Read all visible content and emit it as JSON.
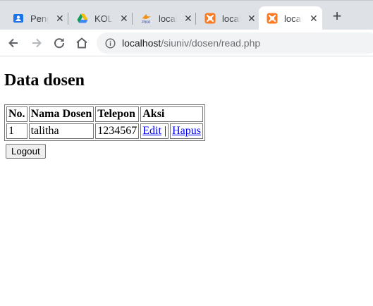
{
  "tabs": [
    {
      "title": "Peng",
      "icon": "contact-card-icon"
    },
    {
      "title": "KOLA",
      "icon": "google-drive-icon"
    },
    {
      "title": "local",
      "icon": "phpmyadmin-icon"
    },
    {
      "title": "local",
      "icon": "xampp-icon"
    },
    {
      "title": "local",
      "icon": "xampp-icon",
      "active": true
    }
  ],
  "new_tab_label": "+",
  "address": {
    "host": "localhost",
    "path": "/siuniv/dosen/read.php"
  },
  "page": {
    "title": "Data dosen",
    "table": {
      "headers": [
        "No.",
        "Nama Dosen",
        "Telepon",
        "Aksi"
      ],
      "rows": [
        {
          "no": "1",
          "nama": "talitha",
          "telepon": "1234567",
          "edit": "Edit",
          "separator": "|",
          "hapus": "Hapus"
        }
      ]
    },
    "logout_label": "Logout"
  },
  "colors": {
    "link": "#0000ee",
    "tabstrip": "#dee1e6",
    "omnibox": "#f1f3f4",
    "xampp": "#fb7a24",
    "contact": "#1a73e8"
  }
}
